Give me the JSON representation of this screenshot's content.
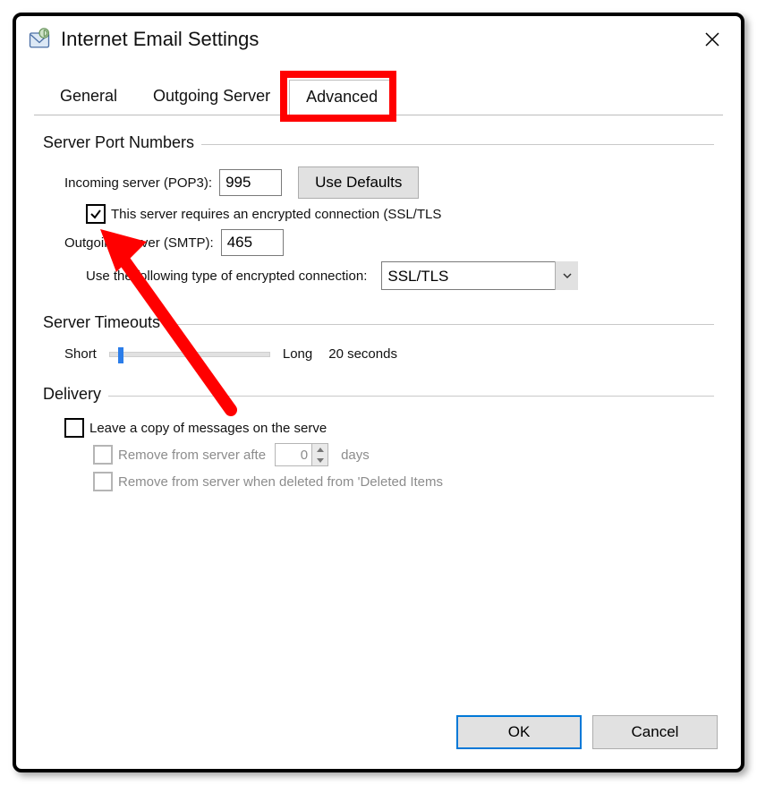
{
  "window": {
    "title": "Internet Email Settings"
  },
  "tabs": {
    "general": "General",
    "outgoing": "Outgoing Server",
    "advanced": "Advanced",
    "active": "advanced"
  },
  "groups": {
    "server_ports": "Server Port Numbers",
    "server_timeouts": "Server Timeouts",
    "delivery": "Delivery"
  },
  "server_ports": {
    "incoming_label": "Incoming server (POP3):",
    "incoming_value": "995",
    "use_defaults": "Use Defaults",
    "ssl_checkbox_checked": true,
    "ssl_checkbox_label": "This server requires an encrypted connection (SSL/TLS",
    "outgoing_label": "Outgoing server (SMTP):",
    "outgoing_value": "465",
    "enc_type_label": "Use the following type of encrypted connection:",
    "enc_type_value": "SSL/TLS"
  },
  "server_timeouts": {
    "short_label": "Short",
    "long_label": "Long",
    "value_label": "20 seconds",
    "slider_percent": 5
  },
  "delivery": {
    "leave_copy_checked": false,
    "leave_copy_label": "Leave a copy of messages on the serve",
    "remove_after_label": "Remove from server afte",
    "remove_after_days_value": "0",
    "remove_after_days_unit": "days",
    "remove_deleted_label": "Remove from server when deleted from 'Deleted Items"
  },
  "buttons": {
    "ok": "OK",
    "cancel": "Cancel"
  },
  "annotation": {
    "highlight_tab": "advanced",
    "arrow_points_to": "ssl-checkbox"
  }
}
